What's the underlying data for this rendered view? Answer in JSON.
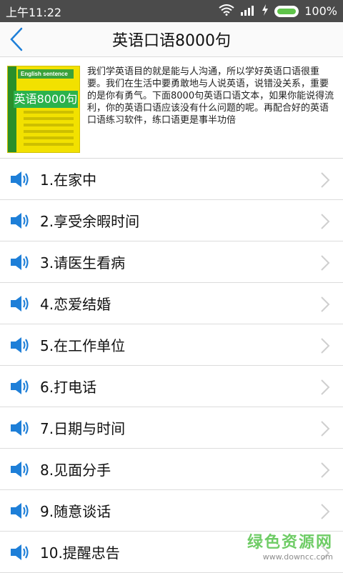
{
  "status_bar": {
    "time": "上午11:22",
    "battery": "100%"
  },
  "header": {
    "title": "英语口语8000句"
  },
  "intro": {
    "cover_en": "English sentence",
    "cover_cn": "英语8000句",
    "text": "我们学英语目的就是能与人沟通，所以学好英语口语很重要。我们在生活中要勇敢地与人说英语，说错没关系，重要的是你有勇气。下面8000句英语口语文本，如果你能说得流利，你的英语口语应该没有什么问题的呢。再配合好的英语口语练习软件，练口语更是事半功倍"
  },
  "list": {
    "items": [
      {
        "label": "1.在家中"
      },
      {
        "label": "2.享受余暇时间"
      },
      {
        "label": "3.请医生看病"
      },
      {
        "label": "4.恋爱结婚"
      },
      {
        "label": "5.在工作单位"
      },
      {
        "label": "6.打电话"
      },
      {
        "label": "7.日期与时间"
      },
      {
        "label": "8.见面分手"
      },
      {
        "label": "9.随意谈话"
      },
      {
        "label": "10.提醒忠告"
      }
    ]
  },
  "watermark": {
    "cn": "绿色资源网",
    "url": "www.downcc.com"
  },
  "colors": {
    "speaker_blue": "#1e7fd8",
    "status_bg": "#4b4b4b"
  },
  "icons": [
    "back-arrow-icon",
    "speaker-icon",
    "chevron-right-icon",
    "wifi-icon",
    "signal-icon",
    "battery-icon"
  ]
}
